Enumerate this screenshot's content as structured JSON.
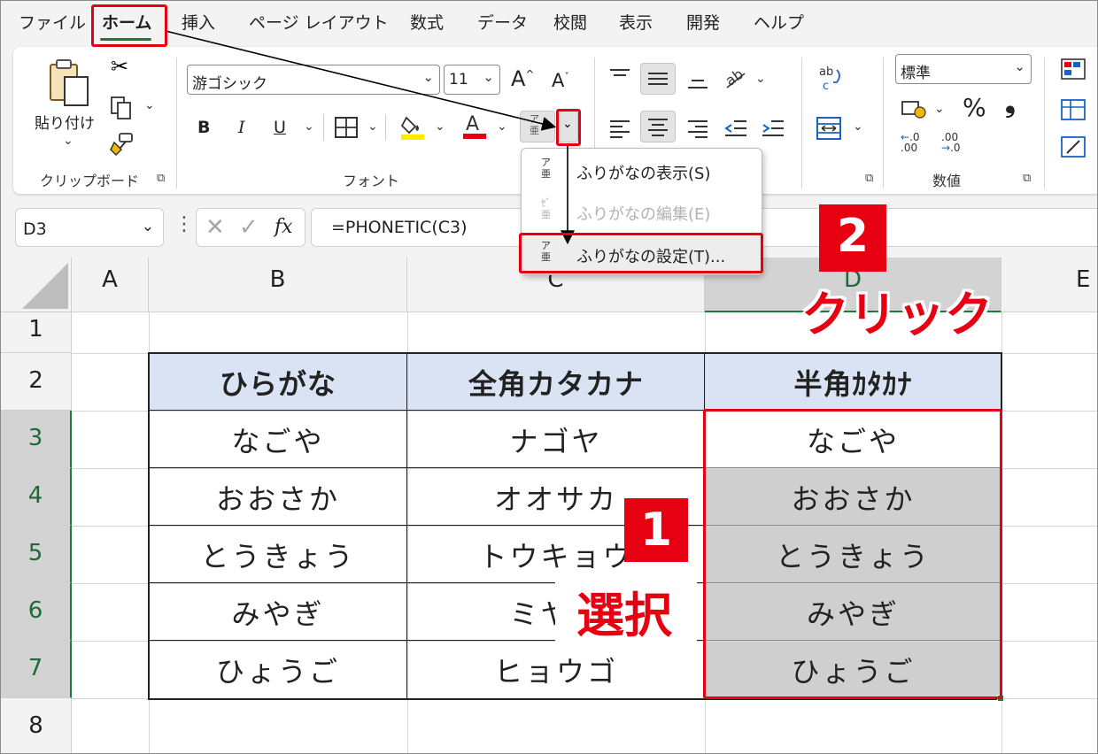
{
  "menu": {
    "items": [
      "ファイル",
      "ホーム",
      "挿入",
      "ページ レイアウト",
      "数式",
      "データ",
      "校閲",
      "表示",
      "開発",
      "ヘルプ"
    ],
    "active": "ホーム"
  },
  "ribbon": {
    "clipboard": {
      "paste_label": "貼り付け",
      "group_label": "クリップボード"
    },
    "font": {
      "font_name": "游ゴシック",
      "font_size": "11",
      "bold": "B",
      "italic": "I",
      "underline": "U",
      "increase_size": "A",
      "decrease_size": "A",
      "group_label": "フォント"
    },
    "number": {
      "format": "標準",
      "percent": "%",
      "comma": "❟",
      "group_label": "数値"
    }
  },
  "formula_bar": {
    "name_box": "D3",
    "fx": "fx",
    "formula": "=PHONETIC(C3)"
  },
  "furigana_menu": {
    "items": [
      {
        "label": "ふりがなの表示(S)",
        "disabled": false
      },
      {
        "label": "ふりがなの編集(E)",
        "disabled": true
      },
      {
        "label": "ふりがなの設定(T)...",
        "disabled": false
      }
    ]
  },
  "sheet": {
    "columns": [
      "A",
      "B",
      "C",
      "D",
      "E"
    ],
    "rows": [
      "1",
      "2",
      "3",
      "4",
      "5",
      "6",
      "7",
      "8"
    ],
    "selected_column": "D",
    "selected_rows": [
      "3",
      "4",
      "5",
      "6",
      "7"
    ],
    "headers": [
      "ひらがな",
      "全角カタカナ",
      "半角ｶﾀｶﾅ"
    ],
    "table": [
      [
        "なごや",
        "ナゴヤ",
        "なごや"
      ],
      [
        "おおさか",
        "オオサカ",
        "おおさか"
      ],
      [
        "とうきょう",
        "トウキョウ",
        "とうきょう"
      ],
      [
        "みやぎ",
        "ミヤギ",
        "みやぎ"
      ],
      [
        "ひょうご",
        "ヒョウゴ",
        "ひょうご"
      ]
    ]
  },
  "annotations": {
    "step1_number": "1",
    "step1_text": "選択",
    "step2_number": "2",
    "step2_text": "クリック"
  },
  "colors": {
    "accent_red": "#e60012",
    "excel_green": "#1d7a3a",
    "header_fill": "#dae3f3",
    "selection_fill": "#cfcfcf"
  }
}
